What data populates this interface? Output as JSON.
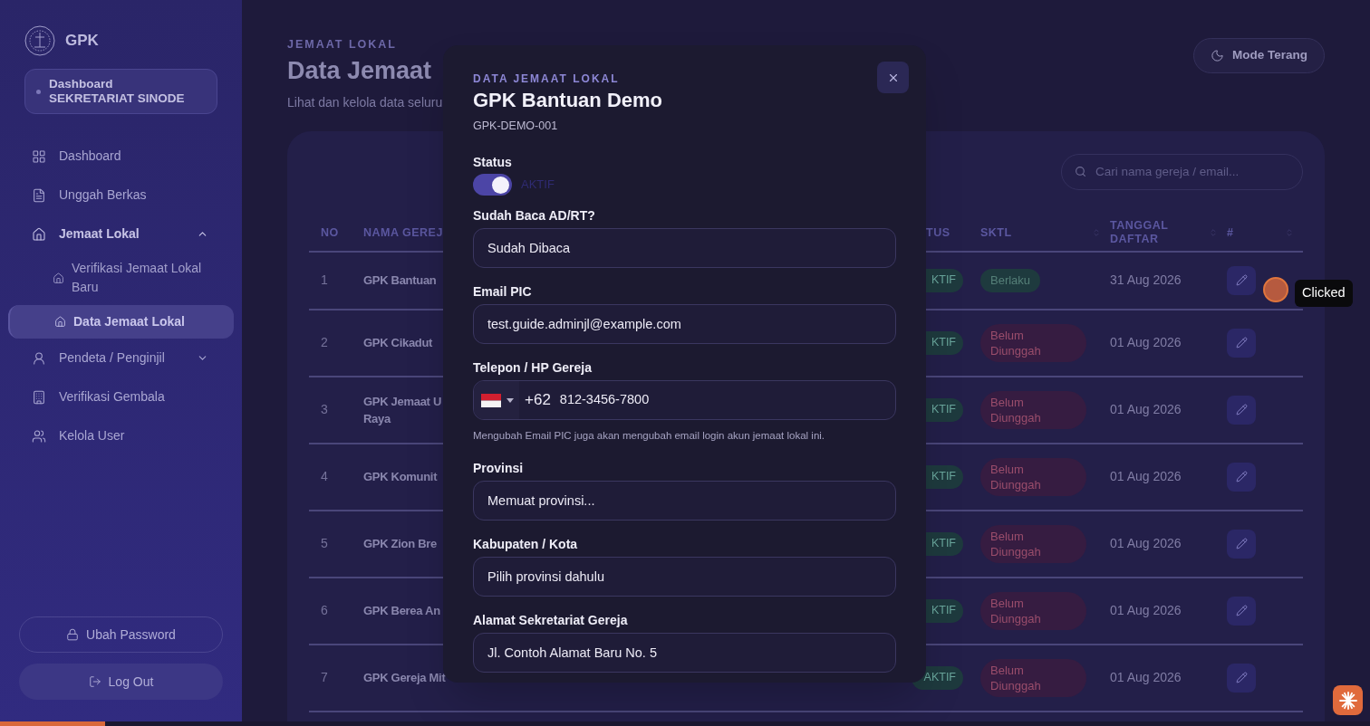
{
  "sidebar": {
    "brand": "GPK",
    "role_card": {
      "title": "Dashboard",
      "subtitle": "SEKRETARIAT SINODE"
    },
    "items": [
      {
        "kind": "link",
        "label": "Dashboard",
        "selected": false
      },
      {
        "kind": "link",
        "label": "Unggah Berkas",
        "selected": false
      },
      {
        "kind": "group",
        "label": "Jemaat Lokal",
        "selected": false,
        "expanded": true,
        "children": [
          {
            "label": "Verifikasi Jemaat Lokal Baru",
            "selected": false
          },
          {
            "label": "Data Jemaat Lokal",
            "selected": true
          }
        ]
      },
      {
        "kind": "group",
        "label": "Pendeta / Penginjil",
        "selected": false,
        "expanded": false
      },
      {
        "kind": "link",
        "label": "Verifikasi Gembala",
        "selected": false
      },
      {
        "kind": "link",
        "label": "Kelola User",
        "selected": false
      }
    ],
    "buttons": [
      {
        "kind": "outline",
        "label": "Ubah Password"
      },
      {
        "kind": "filled",
        "label": "Log Out"
      }
    ]
  },
  "header": {
    "eyebrow": "JEMAAT LOKAL",
    "title": "Data Jemaat",
    "subtitle": "Lihat dan kelola data seluru",
    "theme_button": "Mode Terang"
  },
  "table": {
    "search": {
      "placeholder": "Cari nama gereja / email..."
    },
    "columns": [
      {
        "label": "NO"
      },
      {
        "label": "NAMA GEREJ"
      },
      {
        "label": "TUS"
      },
      {
        "label": "SKTL"
      },
      {
        "label": "TANGGAL DAFTAR"
      },
      {
        "label": "#"
      }
    ],
    "rows": [
      {
        "no": "1",
        "name_lines": [
          "GPK Bantuan"
        ],
        "status": "KTIF",
        "sktl": {
          "text": "Berlaku",
          "kind": "valid"
        },
        "date": "31 Aug 2026"
      },
      {
        "no": "2",
        "name_lines": [
          "GPK Cikadut"
        ],
        "status": "KTIF",
        "sktl": {
          "text": "Belum Diunggah",
          "kind": "missing"
        },
        "date": "01 Aug 2026"
      },
      {
        "no": "3",
        "name_lines": [
          "GPK Jemaat U",
          "Raya"
        ],
        "status": "KTIF",
        "sktl": {
          "text": "Belum Diunggah",
          "kind": "missing"
        },
        "date": "01 Aug 2026"
      },
      {
        "no": "4",
        "name_lines": [
          "GPK Komunit"
        ],
        "status": "KTIF",
        "sktl": {
          "text": "Belum Diunggah",
          "kind": "missing"
        },
        "date": "01 Aug 2026"
      },
      {
        "no": "5",
        "name_lines": [
          "GPK Zion Bre"
        ],
        "status": "KTIF",
        "sktl": {
          "text": "Belum Diunggah",
          "kind": "missing"
        },
        "date": "01 Aug 2026"
      },
      {
        "no": "6",
        "name_lines": [
          "GPK Berea An"
        ],
        "status": "KTIF",
        "sktl": {
          "text": "Belum Diunggah",
          "kind": "missing"
        },
        "date": "01 Aug 2026"
      },
      {
        "no": "7",
        "name_lines": [
          "GPK Gereja Mit"
        ],
        "status": "AKTIF",
        "sktl": {
          "text": "Belum Diunggah",
          "kind": "missing"
        },
        "date": "01 Aug 2026"
      }
    ]
  },
  "modal": {
    "eyebrow": "DATA JEMAAT LOKAL",
    "title": "GPK Bantuan Demo",
    "code": "GPK-DEMO-001",
    "status": {
      "label": "Status",
      "on": true,
      "text": "AKTIF"
    },
    "fields": [
      {
        "kind": "text",
        "label": "Sudah Baca AD/RT?",
        "value": "Sudah Dibaca"
      },
      {
        "kind": "text",
        "label": "Email PIC",
        "value": "test.guide.adminjl@example.com"
      },
      {
        "kind": "phone",
        "label": "Telepon / HP Gereja",
        "dial_code": "+62",
        "value": "812-3456-7800",
        "hint": "Mengubah Email PIC juga akan mengubah email login akun jemaat lokal ini."
      },
      {
        "kind": "text",
        "label": "Provinsi",
        "value": "Memuat provinsi..."
      },
      {
        "kind": "text",
        "label": "Kabupaten / Kota",
        "value": "Pilih provinsi dahulu"
      },
      {
        "kind": "text",
        "label": "Alamat Sekretariat Gereja",
        "value": "Jl. Contoh Alamat Baru No. 5"
      }
    ]
  },
  "click_marker": {
    "label": "Clicked"
  },
  "progress": {
    "level": 0.077
  }
}
